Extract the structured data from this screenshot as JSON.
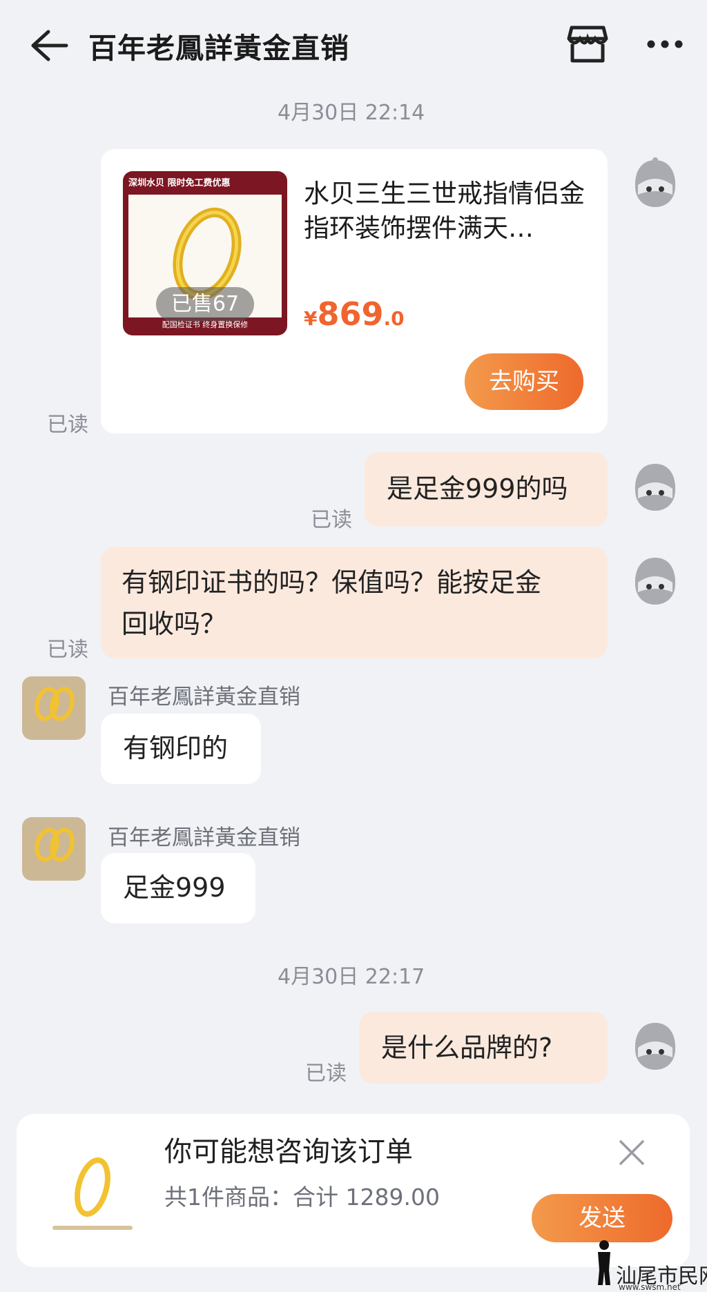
{
  "header": {
    "title": "百年老鳳詳黃金直销",
    "back_icon": "back-arrow-icon",
    "store_icon": "store-icon",
    "more_icon": "more-icon"
  },
  "messages": {
    "time_1": "4月30日 22:14",
    "product": {
      "image_header": "深圳水贝 限时免工费优惠",
      "image_footer": "配国检证书  终身置换保修",
      "sold": "已售67",
      "title": "水贝三生三世戒指情侣金指环装饰摆件满天…",
      "price_currency": "¥",
      "price_int": "869",
      "price_dec": ".0",
      "buy_label": "去购买",
      "read": "已读"
    },
    "msg_1": {
      "text": "是足金999的吗",
      "read": "已读"
    },
    "msg_2": {
      "line1": "有钢印证书的吗？保值吗？能按足金",
      "line2": "回收吗？",
      "read": "已读"
    },
    "reply_1": {
      "sender": "百年老鳳詳黃金直销",
      "text": "有钢印的"
    },
    "reply_2": {
      "sender": "百年老鳳詳黃金直销",
      "text": "足金999"
    },
    "time_2": "4月30日 22:17",
    "msg_3": {
      "text": "是什么品牌的?",
      "read": "已读"
    }
  },
  "order_card": {
    "title": "你可能想咨询该订单",
    "summary": "共1件商品：合计 1289.00",
    "send_label": "发送",
    "close_icon": "close-icon"
  },
  "watermark": {
    "text": "汕尾市民网",
    "url": "www.swsm.net"
  },
  "colors": {
    "background": "#f1f2f6",
    "accent_orange": "#ee6a2c",
    "price": "#f0642e",
    "my_bubble": "#fbe9de"
  }
}
